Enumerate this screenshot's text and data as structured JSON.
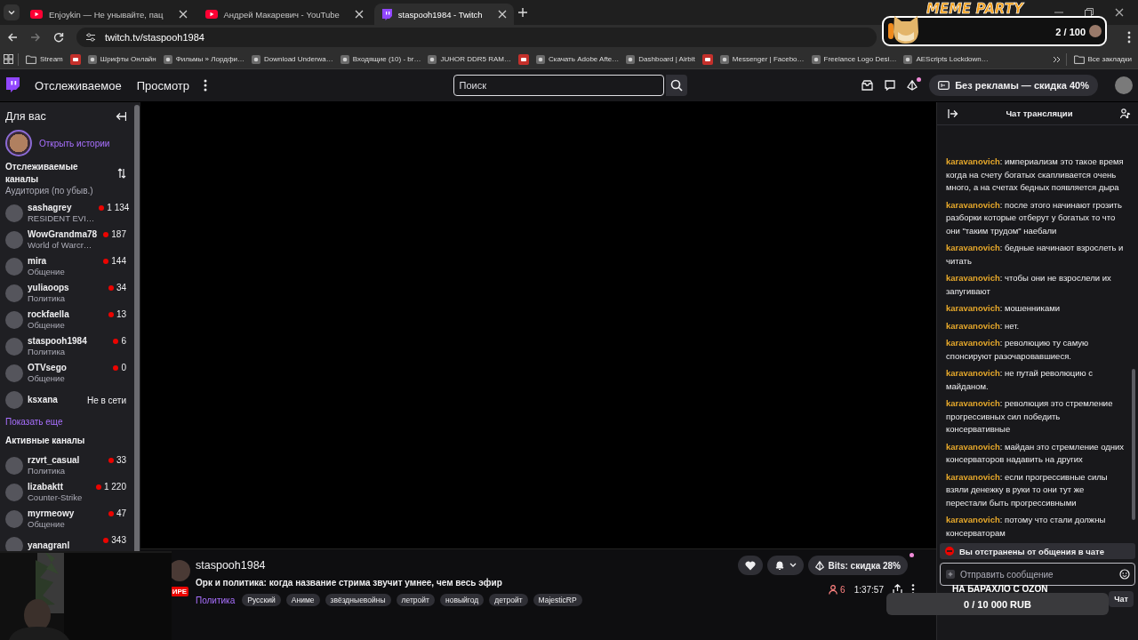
{
  "browser": {
    "tabs": [
      {
        "title": "Enjoykin — Не унывайте, пац",
        "kind": "youtube",
        "selected": false
      },
      {
        "title": "Андрей Макаревич - YouTube",
        "kind": "youtube",
        "selected": false
      },
      {
        "title": "staspooh1984 - Twitch",
        "kind": "twitch",
        "selected": true
      }
    ],
    "url": "twitch.tv/staspooh1984",
    "bookmarks": [
      {
        "label": "Stream",
        "kind": "folder"
      },
      {
        "kind": "icon"
      },
      {
        "label": "Шрифты Онлайн",
        "kind": "site"
      },
      {
        "label": "Фильмы » Лордфи…",
        "kind": "site"
      },
      {
        "label": "Download Underwa…",
        "kind": "site"
      },
      {
        "label": "Входящие (10) - br…",
        "kind": "site"
      },
      {
        "label": "JUHOR DDR5 RAM…",
        "kind": "site"
      },
      {
        "kind": "icon"
      },
      {
        "label": "Скачать Adobe Afte…",
        "kind": "site"
      },
      {
        "label": "Dashboard | Airbit",
        "kind": "site"
      },
      {
        "kind": "icon"
      },
      {
        "label": "Messenger | Facebo…",
        "kind": "site"
      },
      {
        "label": "Freelance Logo Desi…",
        "kind": "site"
      },
      {
        "label": "AEScripts Lockdown…",
        "kind": "site"
      }
    ],
    "all_bookmarks": "Все закладки"
  },
  "topnav": {
    "links": [
      "Отслеживаемое",
      "Просмотр"
    ],
    "search": {
      "placeholder": "Поиск"
    },
    "drops_new": true,
    "promo": "Без рекламы — скидка 40%"
  },
  "sidebar": {
    "title": "Для вас",
    "stories": "Открыть истории",
    "followed_heading": "Отслеживаемые каналы",
    "sort": "Аудитория (по убыв.)",
    "channels": [
      {
        "name": "sashagrey",
        "category": "RESIDENT EVI…",
        "live": true,
        "viewers": "1 134"
      },
      {
        "name": "WowGrandma78",
        "category": "World of Warcr…",
        "live": true,
        "viewers": "187"
      },
      {
        "name": "mira",
        "category": "Общение",
        "live": true,
        "viewers": "144"
      },
      {
        "name": "yuliaoops",
        "category": "Политика",
        "live": true,
        "viewers": "34"
      },
      {
        "name": "rockfaella",
        "category": "Общение",
        "live": true,
        "viewers": "13"
      },
      {
        "name": "staspooh1984",
        "category": "Политика",
        "live": true,
        "viewers": "6"
      },
      {
        "name": "OTVsego",
        "category": "Общение",
        "live": true,
        "viewers": "0"
      },
      {
        "name": "ksxana",
        "live": false,
        "status": "Не в сети"
      }
    ],
    "show_more": "Показать еще",
    "active_heading": "Активные каналы",
    "active_channels": [
      {
        "name": "rzvrt_casual",
        "category": "Политика",
        "live": true,
        "viewers": "33"
      },
      {
        "name": "lizabaktt",
        "category": "Counter-Strike",
        "live": true,
        "viewers": "1 220"
      },
      {
        "name": "myrmeowy",
        "category": "Общение",
        "live": true,
        "viewers": "47"
      },
      {
        "name": "yanagranl",
        "live": true,
        "viewers": "343"
      }
    ]
  },
  "stream": {
    "channel": "staspooh1984",
    "live_badge": "ИРЕ",
    "title": "Орк и политика: когда название стрима звучит умнее, чем весь эфир",
    "category": "Политика",
    "tags": [
      "Русский",
      "Аниме",
      "звёздныевойны",
      "летройт",
      "новыйгод",
      "детройт",
      "MajesticRP"
    ],
    "bits": "Bits: скидка 28%",
    "bits_new": true,
    "viewers": "6",
    "uptime": "1:37:57"
  },
  "chat": {
    "title": "Чат трансляции",
    "messages": [
      {
        "user": "karavanovich",
        "text": ": империализм это такое время когда на счету богатых скапливается очень много, а на счетах бедных появляется дыра"
      },
      {
        "user": "karavanovich",
        "text": ": после этого начинают грозить разборки которые отберут у богатых то что они \"таким трудом\" наебали"
      },
      {
        "user": "karavanovich",
        "text": ": бедные начинают взрослеть и читать"
      },
      {
        "user": "karavanovich",
        "text": ": чтобы они не взрослели их запугивают"
      },
      {
        "user": "karavanovich",
        "text": ": мошенниками"
      },
      {
        "user": "karavanovich",
        "text": ": нет."
      },
      {
        "user": "karavanovich",
        "text": ": революцию ту самую спонсируют разочаровавшиеся."
      },
      {
        "user": "karavanovich",
        "text": ": не путай революцию с майданом."
      },
      {
        "user": "karavanovich",
        "text": ": революция это стремление прогрессивных сил победить консервативные"
      },
      {
        "user": "karavanovich",
        "text": ": майдан это стремление одних консерваторов надавить на других"
      },
      {
        "user": "karavanovich",
        "text": ": если прогрессивные силы взяли денежку в руки то они тут же перестали быть прогрессивными"
      },
      {
        "user": "karavanovich",
        "text": ": потому что стали должны консерваторам"
      }
    ],
    "notice": "Вы отстранены от общения в чате",
    "input": {
      "placeholder": "Отправить сообщение"
    },
    "chat_button": "Чат"
  },
  "overlays": {
    "meme": {
      "title": "MEME PARTY",
      "count": "2 / 100"
    },
    "goal": {
      "title": "НА БАРАХЛО С OZON",
      "progress": "0 / 10 000 RUB",
      "level": 0
    }
  }
}
